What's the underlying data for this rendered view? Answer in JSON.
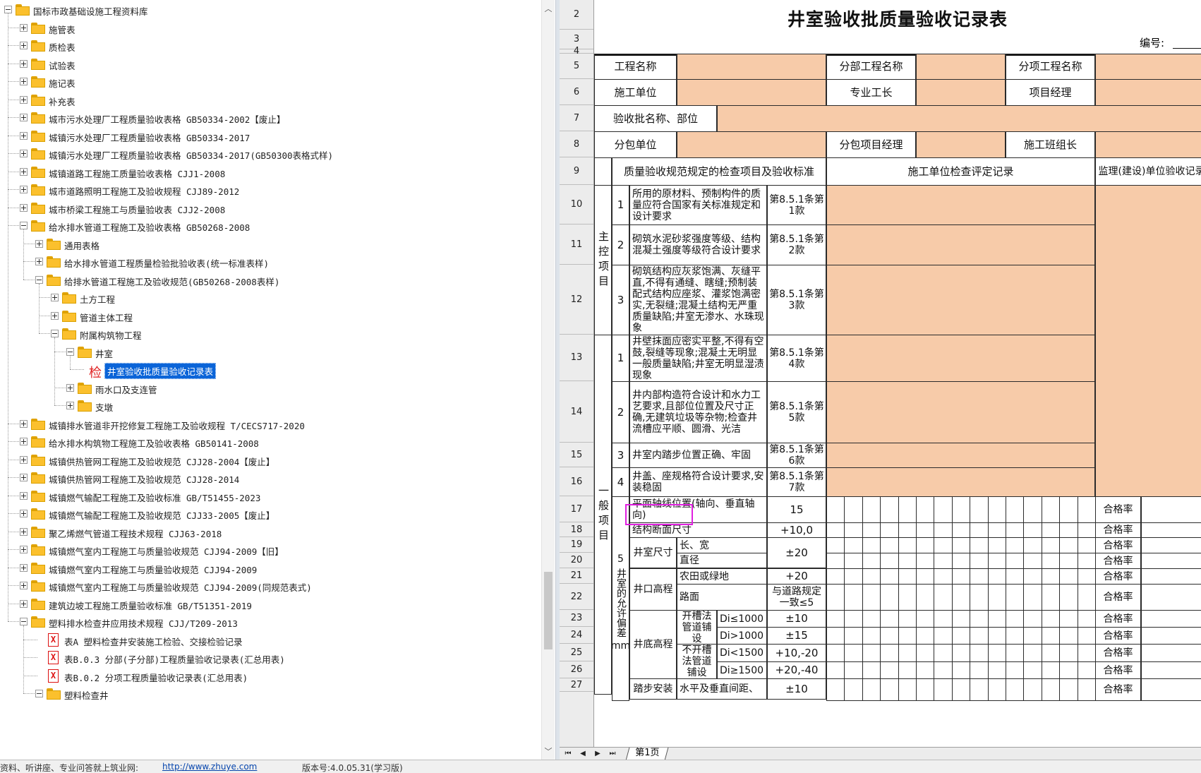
{
  "tree": {
    "items": [
      {
        "label": "国标市政基础设施工程资料库",
        "type": "folder",
        "level": 0,
        "expander": "minus"
      },
      {
        "label": "施管表",
        "type": "folder",
        "level": 1,
        "expander": "plus"
      },
      {
        "label": "质检表",
        "type": "folder",
        "level": 1,
        "expander": "plus"
      },
      {
        "label": "试验表",
        "type": "folder",
        "level": 1,
        "expander": "plus"
      },
      {
        "label": "施记表",
        "type": "folder",
        "level": 1,
        "expander": "plus"
      },
      {
        "label": "补充表",
        "type": "folder",
        "level": 1,
        "expander": "plus"
      },
      {
        "label": "城市污水处理厂工程质量验收表格 GB50334-2002【废止】",
        "type": "folder",
        "level": 1,
        "expander": "plus"
      },
      {
        "label": "城镇污水处理厂工程质量验收表格 GB50334-2017",
        "type": "folder",
        "level": 1,
        "expander": "plus"
      },
      {
        "label": "城镇污水处理厂工程质量验收表格 GB50334-2017(GB50300表格式样)",
        "type": "folder",
        "level": 1,
        "expander": "plus"
      },
      {
        "label": "城镇道路工程施工质量验收表格 CJJ1-2008",
        "type": "folder",
        "level": 1,
        "expander": "plus"
      },
      {
        "label": "城市道路照明工程施工及验收规程 CJJ89-2012",
        "type": "folder",
        "level": 1,
        "expander": "plus"
      },
      {
        "label": "城市桥梁工程施工与质量验收表 CJJ2-2008",
        "type": "folder",
        "level": 1,
        "expander": "plus"
      },
      {
        "label": "给水排水管道工程施工及验收表格 GB50268-2008",
        "type": "folder",
        "level": 1,
        "expander": "minus"
      },
      {
        "label": "通用表格",
        "type": "folder",
        "level": 2,
        "expander": "plus"
      },
      {
        "label": "给水排水管道工程质量检验批验收表(统一标准表样)",
        "type": "folder",
        "level": 2,
        "expander": "plus"
      },
      {
        "label": "给排水管道工程施工及验收规范(GB50268-2008表样)",
        "type": "folder",
        "level": 2,
        "expander": "minus"
      },
      {
        "label": "土方工程",
        "type": "folder",
        "level": 3,
        "expander": "plus"
      },
      {
        "label": "管道主体工程",
        "type": "folder",
        "level": 3,
        "expander": "plus"
      },
      {
        "label": "附属构筑物工程",
        "type": "folder",
        "level": 3,
        "expander": "minus"
      },
      {
        "label": "井室",
        "type": "folder",
        "level": 4,
        "expander": "minus"
      },
      {
        "label": "井室验收批质量验收记录表",
        "type": "jian",
        "level": 5,
        "expander": "none",
        "selected": true,
        "mark": "检"
      },
      {
        "label": "雨水口及支连管",
        "type": "folder",
        "level": 4,
        "expander": "plus"
      },
      {
        "label": "支墩",
        "type": "folder",
        "level": 4,
        "expander": "plus"
      },
      {
        "label": "城镇排水管道非开挖修复工程施工及验收规程 T/CECS717-2020",
        "type": "folder",
        "level": 1,
        "expander": "plus"
      },
      {
        "label": "给水排水构筑物工程施工及验收表格 GB50141-2008",
        "type": "folder",
        "level": 1,
        "expander": "plus"
      },
      {
        "label": "城镇供热管网工程施工及验收规范 CJJ28-2004【废止】",
        "type": "folder",
        "level": 1,
        "expander": "plus"
      },
      {
        "label": "城镇供热管网工程施工及验收规范 CJJ28-2014",
        "type": "folder",
        "level": 1,
        "expander": "plus"
      },
      {
        "label": "城镇燃气输配工程施工及验收标准 GB/T51455-2023",
        "type": "folder",
        "level": 1,
        "expander": "plus"
      },
      {
        "label": "城镇燃气输配工程施工及验收规范 CJJ33-2005【废止】",
        "type": "folder",
        "level": 1,
        "expander": "plus"
      },
      {
        "label": "聚乙烯燃气管道工程技术规程 CJJ63-2018",
        "type": "folder",
        "level": 1,
        "expander": "plus"
      },
      {
        "label": "城镇燃气室内工程施工与质量验收规范 CJJ94-2009【旧】",
        "type": "folder",
        "level": 1,
        "expander": "plus"
      },
      {
        "label": "城镇燃气室内工程施工与质量验收规范 CJJ94-2009",
        "type": "folder",
        "level": 1,
        "expander": "plus"
      },
      {
        "label": "城镇燃气室内工程施工与质量验收规范 CJJ94-2009(同规范表式)",
        "type": "folder",
        "level": 1,
        "expander": "plus"
      },
      {
        "label": "建筑边坡工程施工质量验收标准 GB/T51351-2019",
        "type": "folder",
        "level": 1,
        "expander": "plus"
      },
      {
        "label": "塑料排水检查井应用技术规程 CJJ/T209-2013",
        "type": "folder",
        "level": 1,
        "expander": "minus"
      },
      {
        "label": "表A 塑料检查井安装施工检验、交接检验记录",
        "type": "xdoc",
        "level": 2,
        "expander": "none",
        "mark": "X"
      },
      {
        "label": "表B.0.3 分部(子分部)工程质量验收记录表(汇总用表)",
        "type": "xdoc",
        "level": 2,
        "expander": "none",
        "mark": "X"
      },
      {
        "label": "表B.0.2 分项工程质量验收记录表(汇总用表)",
        "type": "xdoc",
        "level": 2,
        "expander": "none",
        "mark": "X"
      },
      {
        "label": "塑料检查井",
        "type": "folder",
        "level": 2,
        "expander": "minus"
      }
    ]
  },
  "scrollbar": {
    "up": "︿",
    "down": "﹀"
  },
  "status_bar": {
    "left": "资料、听讲座、专业问答就上筑业网:",
    "link": "http://www.zhuye.com",
    "version": "版本号:4.0.05.31(学习版)"
  },
  "sheet": {
    "title": "井室验收批质量验收记录表",
    "code_label": "编号:",
    "row_numbers": [
      "2",
      "3",
      "4",
      "5",
      "6",
      "7",
      "8",
      "9",
      "10",
      "11",
      "12",
      "13",
      "14",
      "15",
      "16",
      "17",
      "18",
      "19",
      "20",
      "21",
      "22",
      "23",
      "24",
      "25",
      "26",
      "27"
    ],
    "header": {
      "project_name": "工程名称",
      "sub_division": "分部工程名称",
      "sub_item": "分项工程名称",
      "construction_unit": "施工单位",
      "foreman": "专业工长",
      "project_manager": "项目经理",
      "batch_name": "验收批名称、部位",
      "subcontractor": "分包单位",
      "sub_pm": "分包项目经理",
      "team_leader": "施工班组长",
      "col_items": "质量验收规范规定的检查项目及验收标准",
      "col_record": "施工单位检查评定记录",
      "col_supervision": "监理(建设)单位验收记录"
    },
    "main_control": {
      "label": "主控项目",
      "items": [
        {
          "no": "1",
          "text": "所用的原材料、预制构件的质量应符合国家有关标准规定和设计要求",
          "clause": "第8.5.1条第1款"
        },
        {
          "no": "2",
          "text": "砌筑水泥砂浆强度等级、结构混凝土强度等级符合设计要求",
          "clause": "第8.5.1条第2款"
        },
        {
          "no": "3",
          "text": "砌筑结构应灰浆饱满、灰缝平直,不得有通缝、瞎缝;预制装配式结构应座浆、灌浆饱满密实,无裂缝;混凝土结构无严重质量缺陷;井室无渗水、水珠现象",
          "clause": "第8.5.1条第3款"
        }
      ]
    },
    "general": {
      "label": "一般项目",
      "items": [
        {
          "no": "1",
          "text": "井壁抹面应密实平整,不得有空鼓,裂缝等现象;混凝土无明显一般质量缺陷;井室无明显湿渍现象",
          "clause": "第8.5.1条第4款"
        },
        {
          "no": "2",
          "text": "井内部构造符合设计和水力工艺要求,且部位位置及尺寸正确,无建筑垃圾等杂物;检查井流槽应平顺、圆滑、光洁",
          "clause": "第8.5.1条第5款"
        },
        {
          "no": "3",
          "text": "井室内踏步位置正确、牢固",
          "clause": "第8.5.1条第6款"
        },
        {
          "no": "4",
          "text": "井盖、座规格符合设计要求,安装稳固",
          "clause": "第8.5.1条第7款"
        }
      ],
      "tolerance_label": "井室的允许偏差",
      "tolerance_unit": "mm",
      "tolerance_no": "5",
      "tolerance_rows": {
        "axis": {
          "name": "平面轴线位置(轴向、垂直轴向)",
          "value": "15"
        },
        "section": {
          "name": "结构断面尺寸",
          "value": "+10,0"
        },
        "size": {
          "name": "井室尺寸",
          "sub": [
            "长、宽",
            "直径"
          ],
          "value": "±20"
        },
        "top": {
          "name": "井口高程",
          "sub": [
            "农田或绿地",
            "路面"
          ],
          "values": [
            "+20",
            "与道路规定一致≤5"
          ]
        },
        "bottom": {
          "name": "井底高程",
          "groups": [
            "开槽法管道铺设",
            "不开槽法管道铺设"
          ],
          "conds": [
            "Di≤1000",
            "Di>1000",
            "Di<1500",
            "Di≥1500"
          ],
          "values": [
            "±10",
            "±15",
            "+10,-20",
            "+20,-40"
          ]
        },
        "step": {
          "name": "踏步安装",
          "sub": "水平及垂直间距、",
          "value": "±10"
        }
      },
      "pass_rate": "合格率"
    },
    "tab": "第1页"
  }
}
